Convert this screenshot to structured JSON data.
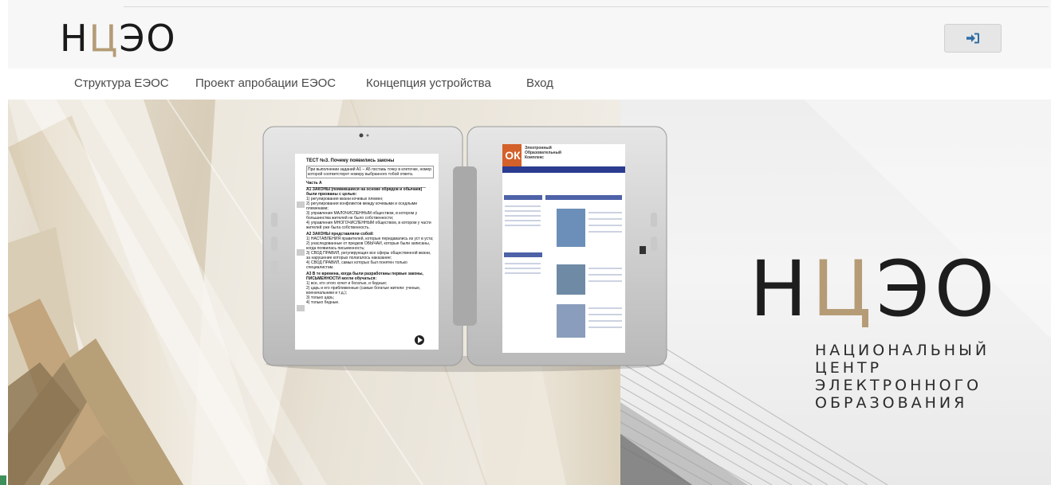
{
  "header": {
    "logo": {
      "part1": "Н",
      "part2": "Ц",
      "part3": "ЭО"
    },
    "login_icon": "sign-in-icon"
  },
  "nav": {
    "items": [
      {
        "label": "Структура ЕЭОС"
      },
      {
        "label": "Проект апробации ЕЭОС"
      },
      {
        "label": "Концепция устройства"
      },
      {
        "label": "Вход"
      }
    ]
  },
  "hero": {
    "brand": {
      "logo": {
        "part1": "Н",
        "part2": "Ц",
        "part3": "ЭО"
      },
      "subtitle": [
        "НАЦИОНАЛЬНЫЙ",
        "ЦЕНТР",
        "ЭЛЕКТРОННОГО",
        "ОБРАЗОВАНИЯ"
      ]
    },
    "device": {
      "left_screen": {
        "title": "ТЕСТ №3. Почему появились законы",
        "intro": "При выполнении заданий А1 – А5 поставь точку в клеточке, номер которой соответствует номеру выбранного тобой ответа.",
        "part": "Часть А",
        "questions": [
          {
            "num": "А1",
            "text": "ЗАКОНЫ (появившиеся на основе обрядов и обычаев) были призваны с целью:",
            "options": [
              "1) регулирования жизни кочевых племен;",
              "2) регулирования конфликтов между кочевыми и оседлыми племенами;",
              "3) управления МАЛОЧИСЛЕННЫМ обществом, в котором у большинства жителей не было собственности;",
              "4) управления МНОГОЧИСЛЕННЫМ обществом, в котором у части жителей уже была собственность."
            ]
          },
          {
            "num": "А2",
            "text": "ЗАКОНЫ представляли собой:",
            "options": [
              "1) НАСТАВЛЕНИЯ правителей, которые передавались из уст в уста;",
              "2) унаследованные от предков ОБЫЧАИ, которые были записаны, когда появилась письменность;",
              "3) СВОД ПРАВИЛ, регулирующих все сферы общественной жизни, за нарушение которых полагалось наказание;",
              "4) СВОД ПРАВИЛ, самых которых был понятен только специалистам."
            ]
          },
          {
            "num": "А3",
            "text": "В те времена, когда были разработаны первые законы, ПИСЬМЕННОСТИ могли обучаться:",
            "options": [
              "1) все, кто этого хочет и богатые, и бедные;",
              "2) царь и его приближенные (самые богатые жители: ученые, военачальники и т.д.);",
              "3) только царь;",
              "4) только бедные."
            ]
          }
        ]
      },
      "right_screen": {
        "site_logo": "ОК",
        "site_title": [
          "Электронный",
          "Образовательный",
          "Комплекс"
        ]
      }
    }
  }
}
